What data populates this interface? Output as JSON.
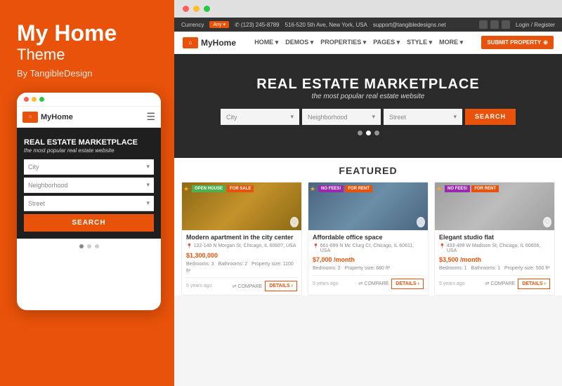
{
  "left": {
    "title": "My Home",
    "subtitle": "Theme",
    "by_line": "By TangibleDesign",
    "mobile": {
      "logo_text": "MyHome",
      "hero_title": "REAL ESTATE MARKETPLACE",
      "hero_sub": "the most popular real estate website",
      "selects": [
        "City",
        "Neighborhood",
        "Street"
      ],
      "search_btn": "SEARCH",
      "dots": [
        true,
        false,
        false
      ]
    }
  },
  "desktop": {
    "window_dots": [
      "red",
      "yellow",
      "green"
    ],
    "topbar": {
      "phone": "✆ (123) 245-8789",
      "address": "516-520 5th Ave, New York, USA",
      "email": "support@tangibledesigns.net",
      "login": "Login / Register",
      "currency_label": "Currency",
      "currency_value": "Any"
    },
    "nav": {
      "logo_text": "MyHome",
      "links": [
        "HOME",
        "DEMOS",
        "PROPERTIES",
        "PAGES",
        "STYLE",
        "MORE"
      ],
      "submit_btn": "SUBMIT PROPERTY"
    },
    "hero": {
      "title": "REAL ESTATE MARKETPLACE",
      "subtitle": "the most popular real estate website",
      "selects": [
        "City",
        "Neighborhood",
        "Street"
      ],
      "search_btn": "SEARCH",
      "dots": [
        false,
        true,
        false
      ]
    },
    "featured": {
      "title": "FEATURED",
      "cards": [
        {
          "badges": [
            {
              "label": "OPEN HOUSE",
              "type": "open"
            },
            {
              "label": "FOR SALE",
              "type": "sale"
            }
          ],
          "title": "Modern apartment in the city center",
          "address": "122-140 N Morgan St, Chicago, IL 60607, USA",
          "price": "$1,300,000",
          "price_suffix": "",
          "details": "Bedrooms: 3  Bathrooms: 2  Property size: 1100 ft²",
          "age": "5 years ago",
          "img_class": "card-img-1"
        },
        {
          "badges": [
            {
              "label": "NO FEES!",
              "type": "nofee"
            },
            {
              "label": "FOR RENT",
              "type": "rent"
            }
          ],
          "title": "Affordable office space",
          "address": "661-699 N Mc Clurg Ct, Chicago, IL 60611, USA",
          "price": "$7,000/month",
          "price_suffix": "",
          "details": "Bedrooms: 2  Property size: 680 ft²",
          "age": "5 years ago",
          "img_class": "card-img-2"
        },
        {
          "badges": [
            {
              "label": "NO FEES!",
              "type": "nofee"
            },
            {
              "label": "FOR RENT",
              "type": "rent"
            }
          ],
          "title": "Elegant studio flat",
          "address": "433-499 W Madison St, Chicago, IL 60606, USA",
          "price": "$3,500/month",
          "price_suffix": "",
          "details": "Bedrooms: 1  Bathrooms: 1  Property size: 500 ft²",
          "age": "5 years ago",
          "img_class": "card-img-3"
        }
      ]
    }
  },
  "icons": {
    "hamburger": "☰",
    "chevron_down": "▾",
    "map_pin": "📍",
    "star": "★",
    "heart": "♡",
    "compare": "⇄",
    "arrow_right": "›"
  }
}
